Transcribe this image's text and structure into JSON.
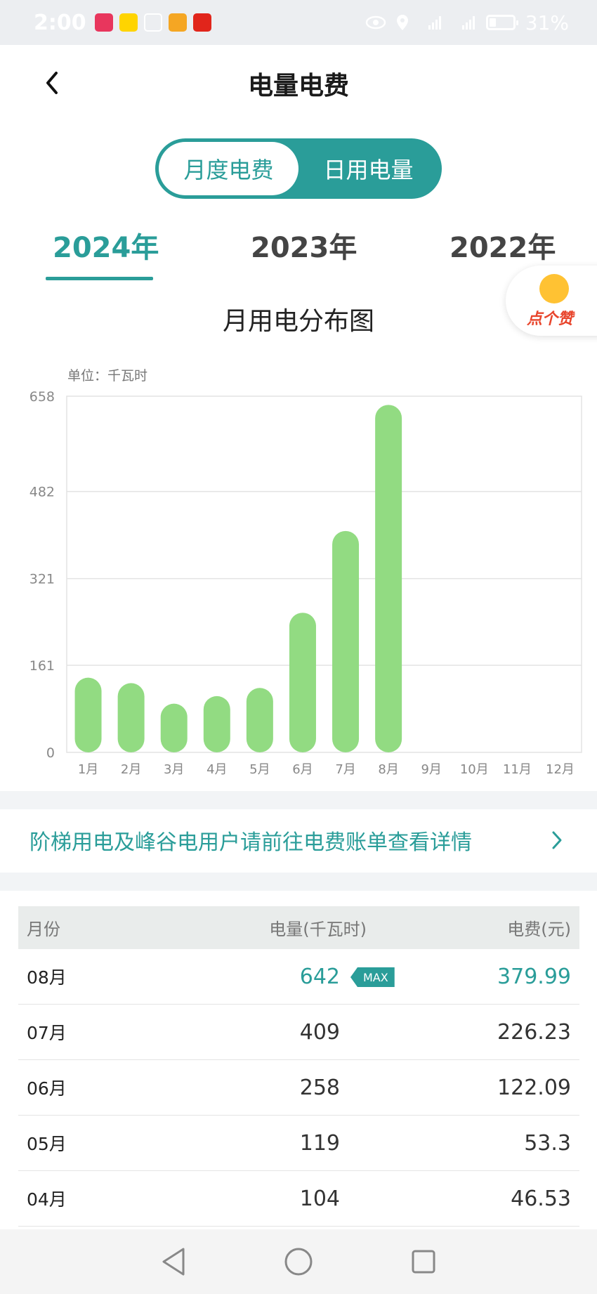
{
  "status_bar": {
    "time": "2:00",
    "battery": "31%",
    "battery_level": 0.31
  },
  "header": {
    "title": "电量电费"
  },
  "segment": {
    "options": [
      "月度电费",
      "日用电量"
    ],
    "selected": "月度电费"
  },
  "years": {
    "items": [
      "2024年",
      "2023年",
      "2022年"
    ],
    "selected": "2024年"
  },
  "like_badge": {
    "label": "点个赞"
  },
  "chart": {
    "title": "月用电分布图",
    "unit": "单位：千瓦时"
  },
  "chart_data": {
    "type": "bar",
    "categories": [
      "1月",
      "2月",
      "3月",
      "4月",
      "5月",
      "6月",
      "7月",
      "8月",
      "9月",
      "10月",
      "11月",
      "12月"
    ],
    "values": [
      138,
      128,
      90,
      104,
      119,
      258,
      409,
      642,
      null,
      null,
      null,
      null
    ],
    "yticks": [
      "0",
      "161",
      "321",
      "482",
      "658"
    ],
    "ylim": [
      0,
      658
    ],
    "grid": true,
    "bar_color": "#92db82"
  },
  "notice": {
    "text": "阶梯用电及峰谷电用户请前往电费账单查看详情"
  },
  "table": {
    "headers": {
      "month": "月份",
      "kwh": "电量(千瓦时)",
      "fee": "电费(元)"
    },
    "max_tag": "MAX",
    "rows": [
      {
        "month": "08月",
        "kwh": "642",
        "fee": "379.99"
      },
      {
        "month": "07月",
        "kwh": "409",
        "fee": "226.23"
      },
      {
        "month": "06月",
        "kwh": "258",
        "fee": "122.09"
      },
      {
        "month": "05月",
        "kwh": "119",
        "fee": "53.3"
      },
      {
        "month": "04月",
        "kwh": "104",
        "fee": "46.53"
      }
    ]
  },
  "colors": {
    "accent": "#2a9d99",
    "bar": "#92db82"
  }
}
